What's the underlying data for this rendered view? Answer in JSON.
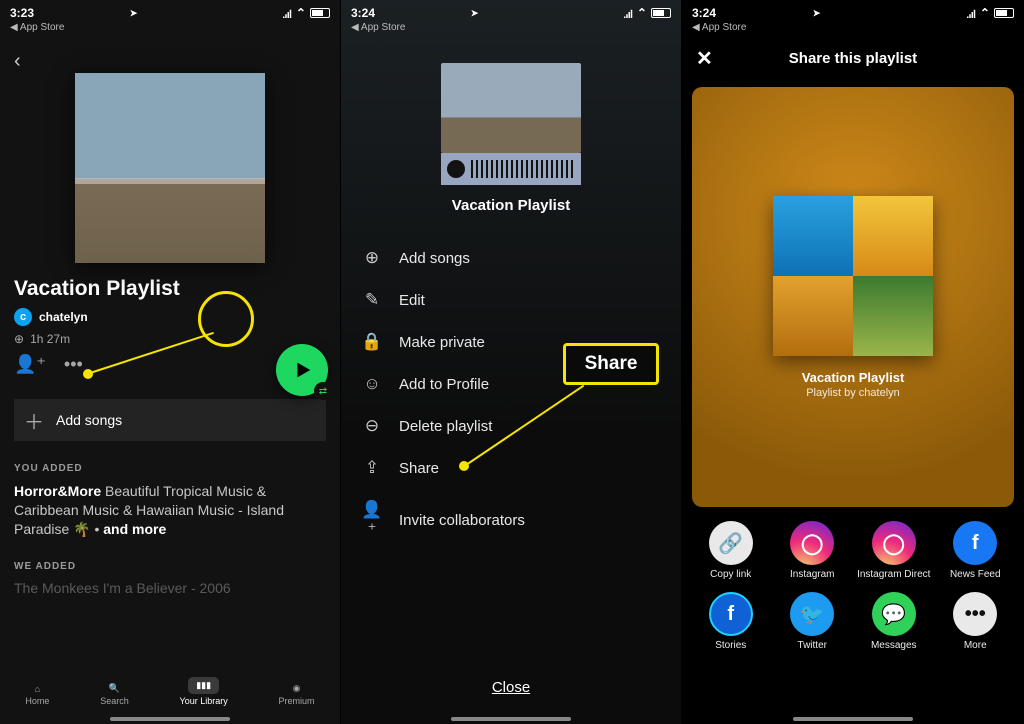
{
  "status": {
    "t1": "3:23",
    "t2": "3:24",
    "t3": "3:24",
    "back_app": "App Store",
    "loc_arrow": "➤"
  },
  "s1": {
    "title": "Vacation Playlist",
    "avatar_initial": "c",
    "owner": "chatelyn",
    "duration": "1h 27m",
    "add_songs": "Add songs",
    "section_you": "YOU ADDED",
    "track1_title": "Horror&More",
    "track1_rest": "Beautiful Tropical Music & Caribbean Music & Hawaiian Music - Island Paradise 🌴  •  ",
    "and_more": "and more",
    "section_we": "WE ADDED",
    "track2": "The Monkees I'm a Believer - 2006",
    "tabs": {
      "home": "Home",
      "search": "Search",
      "library": "Your Library",
      "premium": "Premium"
    }
  },
  "s2": {
    "title": "Vacation Playlist",
    "items": {
      "add": "Add songs",
      "edit": "Edit",
      "private": "Make private",
      "profile": "Add to Profile",
      "delete": "Delete playlist",
      "share": "Share",
      "invite": "Invite collaborators"
    },
    "close": "Close",
    "callout": "Share"
  },
  "s3": {
    "header": "Share this playlist",
    "ptitle": "Vacation Playlist",
    "sub": "Playlist by chatelyn",
    "targets": {
      "copy": "Copy link",
      "instagram": "Instagram",
      "instadirect": "Instagram Direct",
      "newsfeed": "News Feed",
      "stories": "Stories",
      "twitter": "Twitter",
      "messages": "Messages",
      "more": "More"
    }
  }
}
